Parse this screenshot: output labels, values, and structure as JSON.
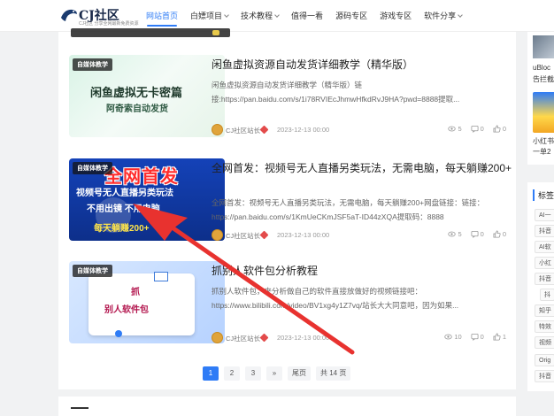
{
  "header": {
    "logo_title": "CJ社区",
    "logo_sub": "CJ社区 分享全网最新免费资源",
    "nav": [
      {
        "label": "网站首页",
        "active": true,
        "dropdown": false
      },
      {
        "label": "白嫖项目",
        "active": false,
        "dropdown": true
      },
      {
        "label": "技术教程",
        "active": false,
        "dropdown": true
      },
      {
        "label": "值得一看",
        "active": false,
        "dropdown": false
      },
      {
        "label": "源码专区",
        "active": false,
        "dropdown": false
      },
      {
        "label": "游戏专区",
        "active": false,
        "dropdown": false
      },
      {
        "label": "软件分享",
        "active": false,
        "dropdown": true
      }
    ]
  },
  "posts": [
    {
      "category": "自媒体教学",
      "title": "闲鱼虚拟资源自动发货详细教学（精华版）",
      "excerpt": "闲鱼虚拟资源自动发货详细教学（精华版）链接:https://pan.baidu.com/s/1i78RVIEcJhmwHfkdRvJ9HA?pwd=8888提取...",
      "thumb_line1": "闲鱼虚拟无卡密篇",
      "thumb_line2": "阿奇索自动发货",
      "author": "CJ社区站长",
      "date": "2023-12-13 00:00",
      "views": "5",
      "comments": "0",
      "likes": "0"
    },
    {
      "category": "自媒体教学",
      "title": "全网首发：视频号无人直播另类玩法，无需电脑，每天躺赚200+",
      "excerpt": "全网首发：视频号无人直播另类玩法，无需电脑，每天躺赚200+网盘链接：链接：https://pan.baidu.com/s/1KmUeCKmJSF5aT-ID44zXQA提取码：8888",
      "thumb_big": "全网首发",
      "thumb_l2": "视频号无人直播另类玩法",
      "thumb_l3": "不用出镜 不用电脑",
      "thumb_l4": "每天躺赚200+",
      "author": "CJ社区站长",
      "date": "2023-12-13 00:00",
      "views": "5",
      "comments": "0",
      "likes": "0"
    },
    {
      "category": "自媒体教学",
      "title": "抓别人软件包分析教程",
      "excerpt": "抓别人软件包，来分析做自己的软件直接放做好的视频链接吧：https://www.bilibili.com/video/BV1xg4y1Z7vq/站长大大同意吧，因为如果...",
      "thumb_line1": "抓",
      "thumb_line2": "别人软件包",
      "author": "CJ社区站长",
      "date": "2023-12-13 00:00",
      "views": "10",
      "comments": "0",
      "likes": "1"
    }
  ],
  "pagination": {
    "pages": [
      "1",
      "2",
      "3"
    ],
    "next": "»",
    "last": "尾页",
    "total": "共 14 页"
  },
  "sidebar": {
    "top_text1": "uBloc",
    "top_text2": "告拦截",
    "top_text3": "小红书",
    "top_text4": "一单2",
    "tags_title": "标签",
    "tags": [
      "AI一",
      "抖音",
      "AI软",
      "小红",
      "抖音",
      "抖",
      "知乎",
      "特效",
      "视频",
      "Orig",
      "抖音"
    ]
  },
  "colors": {
    "accent": "#2f7cf6",
    "annotation_arrow": "#e8322f"
  }
}
